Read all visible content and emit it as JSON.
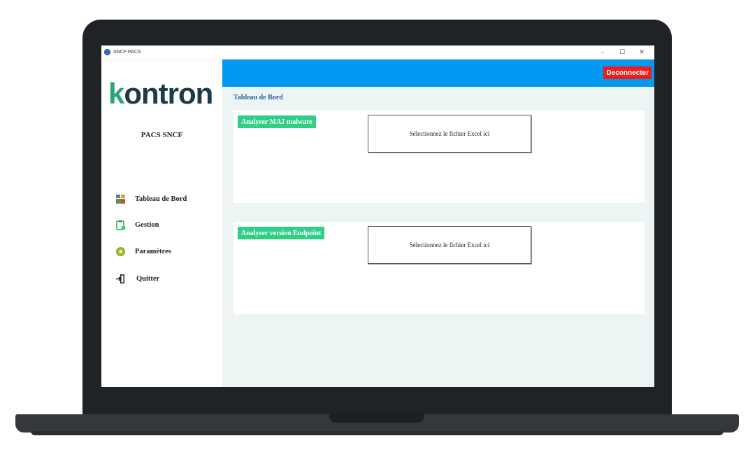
{
  "window": {
    "title": "SNCF PACS",
    "controls": {
      "minimize": "–",
      "maximize": "☐",
      "close": "✕"
    }
  },
  "sidebar": {
    "logo": {
      "k": "k",
      "rest": "ontron"
    },
    "app_name": "PACS SNCF",
    "items": [
      {
        "label": "Tableau de Bord",
        "icon": "dashboard-icon"
      },
      {
        "label": "Gestion",
        "icon": "clipboard-icon"
      },
      {
        "label": "Paramètres",
        "icon": "gear-icon"
      },
      {
        "label": "Quitter",
        "icon": "exit-icon"
      }
    ]
  },
  "topbar": {
    "logout_label": "Deconnecter"
  },
  "main": {
    "title": "Tableau de Bord",
    "cards": [
      {
        "label": "Analyser MAJ malware",
        "file_prompt": "Sélectionnez le fichier Excel ici"
      },
      {
        "label": "Analyser version Endpoint",
        "file_prompt": "Sélectionnez le fichier Excel ici"
      }
    ]
  },
  "colors": {
    "topbar": "#0399f0",
    "logout": "#ee1c1c",
    "card_label": "#2fcf88",
    "page_title": "#2d5fa0",
    "content_bg": "#edf5f4",
    "logo_dark": "#1d3a4a",
    "logo_green": "#2aa57a"
  }
}
